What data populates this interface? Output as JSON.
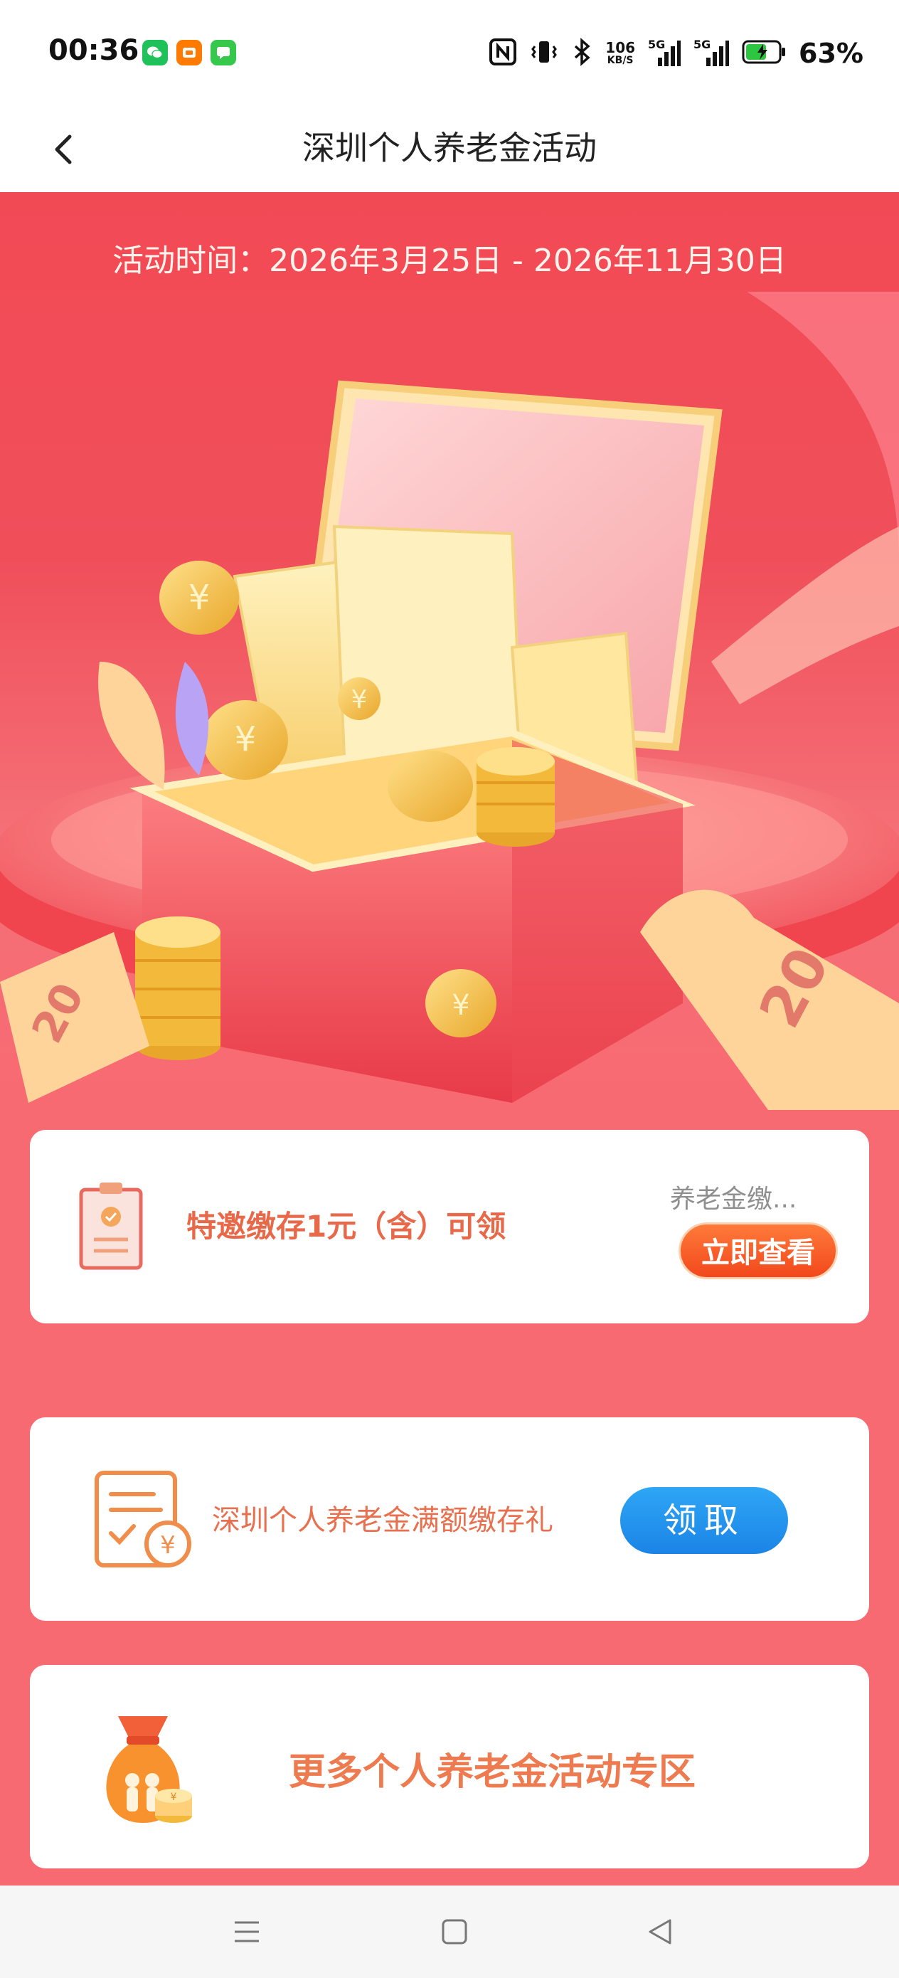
{
  "status_bar": {
    "time": "00:36",
    "apps": [
      "wechat-icon",
      "taobao-icon",
      "messages-icon"
    ],
    "speed_value": "106",
    "speed_unit": "KB/S",
    "signal1_label": "5G",
    "signal2_label": "5G",
    "battery_percent": "63%"
  },
  "nav": {
    "title": "深圳个人养老金活动"
  },
  "hero": {
    "activity_time": "活动时间：2026年3月25日 - 2026年11月30日",
    "ticket_left_value": "20",
    "ticket_right_value": "20",
    "currency_symbol": "¥"
  },
  "card1": {
    "text": "特邀缴存1元（含）可领",
    "subtext": "养老金缴...",
    "button_label": "立即查看"
  },
  "card2": {
    "text": "深圳个人养老金满额缴存礼",
    "button_label": "领取"
  },
  "card3": {
    "text": "更多个人养老金活动专区"
  },
  "colors": {
    "page_bg": "#f86a72",
    "hero_red": "#f24a55",
    "orange_button": "#f2481c",
    "blue_button": "#1a84e6",
    "card_text_orange": "#e8694a"
  }
}
